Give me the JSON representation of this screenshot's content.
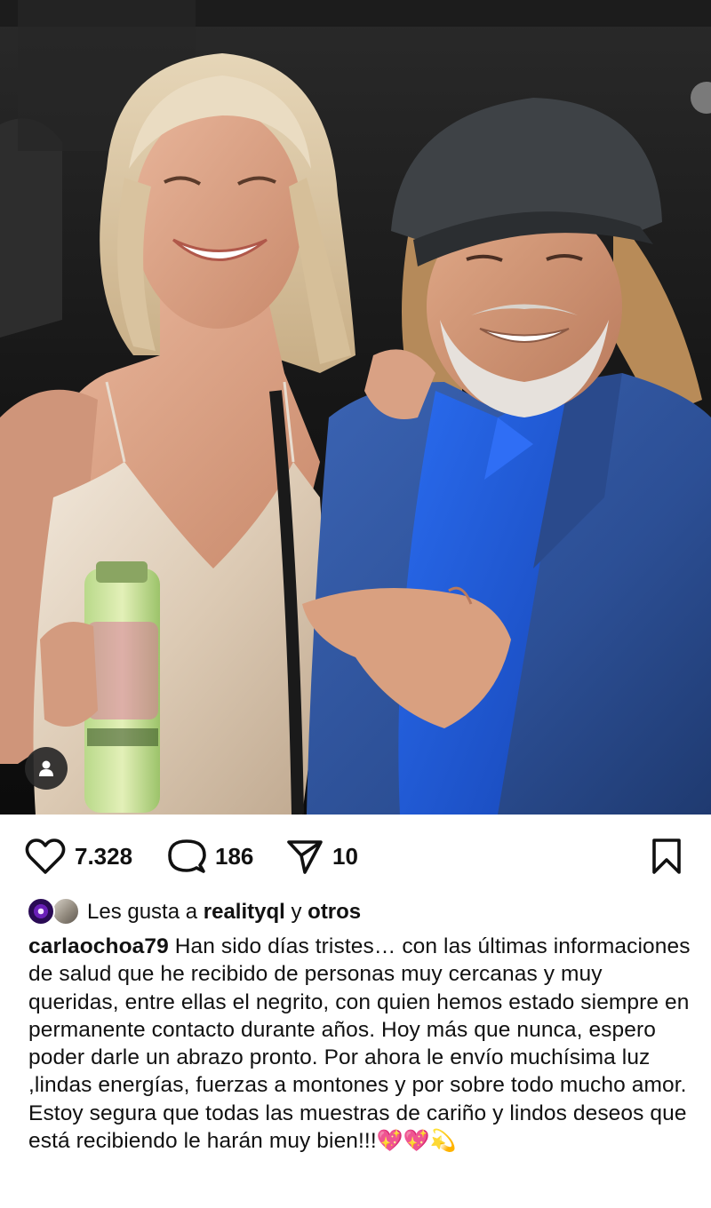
{
  "post": {
    "likes_count": "7.328",
    "comments_count": "186",
    "shares_count": "10",
    "liked_by_prefix": "Les gusta a",
    "liked_by_user": "realityql",
    "liked_by_connector": "y",
    "liked_by_others": "otros",
    "caption_username": "carlaochoa79",
    "caption_text": "Han sido días tristes… con las últimas informaciones de salud que he recibido de personas muy cercanas y muy queridas, entre ellas el negrito, con quien hemos estado siempre en permanente contacto durante años. Hoy más que nunca, espero poder darle un abrazo pronto. Por ahora le envío muchísima luz ,lindas energías, fuerzas a montones y por sobre todo mucho amor. Estoy segura que todas las muestras de cariño y lindos deseos que está recibiendo le harán muy bien!!!",
    "caption_emojis": "💖💖💫"
  },
  "icons": {
    "like": "heart-outline-icon",
    "comment": "speech-bubble-icon",
    "share": "paper-plane-icon",
    "save": "bookmark-icon",
    "tagged": "person-icon"
  },
  "colors": {
    "text": "#111111",
    "background": "#ffffff",
    "photo_background": "#141414",
    "jacket_blue": "#2f57a6",
    "shirt_blue": "#1f5ad8",
    "dress_satin": "#e8dccd"
  }
}
